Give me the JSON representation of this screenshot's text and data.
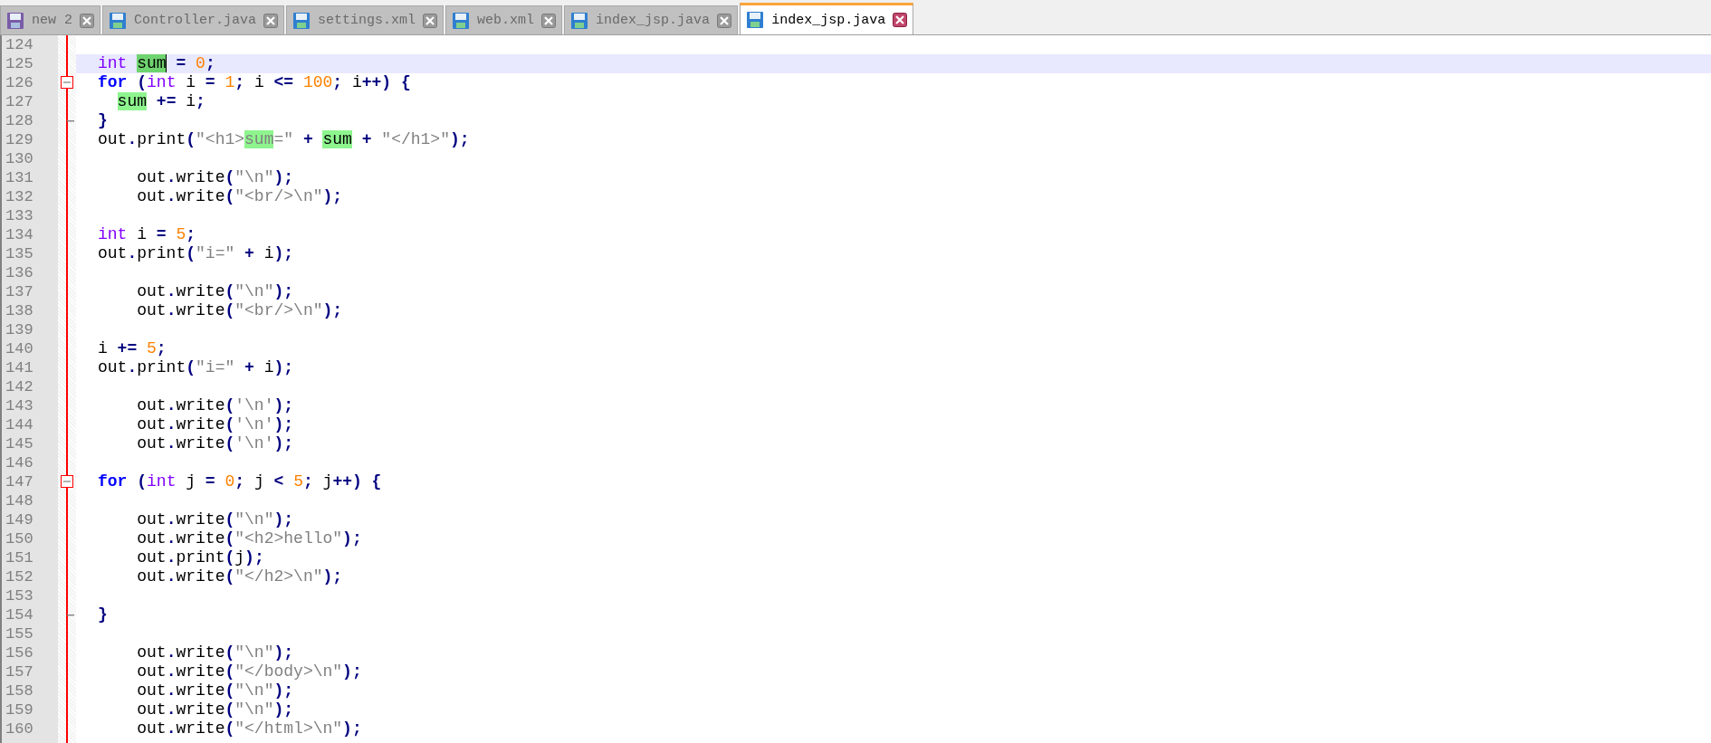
{
  "tabs": [
    {
      "label": "new 2",
      "saved": false,
      "selected": false
    },
    {
      "label": "Controller.java",
      "saved": true,
      "selected": false
    },
    {
      "label": "settings.xml",
      "saved": true,
      "selected": false
    },
    {
      "label": "web.xml",
      "saved": true,
      "selected": false
    },
    {
      "label": "index_jsp.java",
      "saved": true,
      "selected": false
    },
    {
      "label": "index_jsp.java",
      "saved": true,
      "selected": true
    }
  ],
  "editor": {
    "lines": [
      {
        "number": "124",
        "kind": "code",
        "current": false
      },
      {
        "number": "125",
        "kind": "code",
        "current": true,
        "tokens": [
          {
            "text": "int ",
            "kind": "type"
          },
          {
            "text": "sum",
            "kind": "selected"
          },
          {
            "text": " =",
            "kind": "op"
          },
          {
            "text": " 0",
            "kind": "number"
          },
          {
            "text": ";",
            "kind": "op"
          }
        ]
      },
      {
        "number": "126",
        "kind": "fold-start",
        "current": false,
        "tokens": [
          {
            "text": "for ",
            "kind": "keyword"
          },
          {
            "text": "(",
            "kind": "op"
          },
          {
            "text": "int",
            "kind": "type"
          },
          {
            "text": " i ",
            "kind": "plain"
          },
          {
            "text": "= ",
            "kind": "op"
          },
          {
            "text": "1",
            "kind": "number"
          },
          {
            "text": ";",
            "kind": "op"
          },
          {
            "text": " i ",
            "kind": "plain"
          },
          {
            "text": "<= ",
            "kind": "op"
          },
          {
            "text": "100",
            "kind": "number"
          },
          {
            "text": ";",
            "kind": "op"
          },
          {
            "text": " i",
            "kind": "plain"
          },
          {
            "text": "++) {",
            "kind": "op"
          }
        ]
      },
      {
        "number": "127",
        "kind": "code",
        "current": false,
        "tokens": [
          {
            "text": "  sum",
            "kind": "match"
          },
          {
            "text": " +=",
            "kind": "op"
          },
          {
            "text": " i",
            "kind": "plain"
          },
          {
            "text": ";",
            "kind": "op"
          }
        ]
      },
      {
        "number": "128",
        "kind": "fold-end",
        "current": false,
        "tokens": [
          {
            "text": "}",
            "kind": "op"
          }
        ]
      },
      {
        "number": "129",
        "kind": "code",
        "current": false,
        "tokens": [
          {
            "text": "out",
            "kind": "plain"
          },
          {
            "text": ".",
            "kind": "op"
          },
          {
            "text": "print",
            "kind": "plain"
          },
          {
            "text": "(",
            "kind": "op"
          },
          {
            "text": "\"<h1>",
            "kind": "string"
          },
          {
            "text": "sum",
            "kind": "string-match"
          },
          {
            "text": "=\" ",
            "kind": "string"
          },
          {
            "text": "+ ",
            "kind": "op"
          },
          {
            "text": "sum",
            "kind": "match"
          },
          {
            "text": " +",
            "kind": "op"
          },
          {
            "text": " \"</h1>\"",
            "kind": "string"
          },
          {
            "text": ");",
            "kind": "op"
          }
        ]
      },
      {
        "number": "130",
        "kind": "code",
        "current": false
      },
      {
        "number": "131",
        "kind": "code",
        "current": false,
        "tokens": [
          {
            "text": "    out",
            "kind": "plain"
          },
          {
            "text": ".",
            "kind": "op"
          },
          {
            "text": "write",
            "kind": "plain"
          },
          {
            "text": "(",
            "kind": "op"
          },
          {
            "text": "\"\\n\"",
            "kind": "string"
          },
          {
            "text": ");",
            "kind": "op"
          }
        ]
      },
      {
        "number": "132",
        "kind": "code",
        "current": false,
        "tokens": [
          {
            "text": "    out",
            "kind": "plain"
          },
          {
            "text": ".",
            "kind": "op"
          },
          {
            "text": "write",
            "kind": "plain"
          },
          {
            "text": "(",
            "kind": "op"
          },
          {
            "text": "\"<br/>\\n\"",
            "kind": "string"
          },
          {
            "text": ");",
            "kind": "op"
          }
        ]
      },
      {
        "number": "133",
        "kind": "code",
        "current": false
      },
      {
        "number": "134",
        "kind": "code",
        "current": false,
        "tokens": [
          {
            "text": "int",
            "kind": "type"
          },
          {
            "text": " i ",
            "kind": "plain"
          },
          {
            "text": "= ",
            "kind": "op"
          },
          {
            "text": "5",
            "kind": "number"
          },
          {
            "text": ";",
            "kind": "op"
          }
        ]
      },
      {
        "number": "135",
        "kind": "code",
        "current": false,
        "tokens": [
          {
            "text": "out",
            "kind": "plain"
          },
          {
            "text": ".",
            "kind": "op"
          },
          {
            "text": "print",
            "kind": "plain"
          },
          {
            "text": "(",
            "kind": "op"
          },
          {
            "text": "\"i=\" ",
            "kind": "string"
          },
          {
            "text": "+",
            "kind": "op"
          },
          {
            "text": " i",
            "kind": "plain"
          },
          {
            "text": ");",
            "kind": "op"
          }
        ]
      },
      {
        "number": "136",
        "kind": "code",
        "current": false
      },
      {
        "number": "137",
        "kind": "code",
        "current": false,
        "tokens": [
          {
            "text": "    out",
            "kind": "plain"
          },
          {
            "text": ".",
            "kind": "op"
          },
          {
            "text": "write",
            "kind": "plain"
          },
          {
            "text": "(",
            "kind": "op"
          },
          {
            "text": "\"\\n\"",
            "kind": "string"
          },
          {
            "text": ");",
            "kind": "op"
          }
        ]
      },
      {
        "number": "138",
        "kind": "code",
        "current": false,
        "tokens": [
          {
            "text": "    out",
            "kind": "plain"
          },
          {
            "text": ".",
            "kind": "op"
          },
          {
            "text": "write",
            "kind": "plain"
          },
          {
            "text": "(",
            "kind": "op"
          },
          {
            "text": "\"<br/>\\n\"",
            "kind": "string"
          },
          {
            "text": ");",
            "kind": "op"
          }
        ]
      },
      {
        "number": "139",
        "kind": "code",
        "current": false
      },
      {
        "number": "140",
        "kind": "code",
        "current": false,
        "tokens": [
          {
            "text": "i ",
            "kind": "plain"
          },
          {
            "text": "+= ",
            "kind": "op"
          },
          {
            "text": "5",
            "kind": "number"
          },
          {
            "text": ";",
            "kind": "op"
          }
        ]
      },
      {
        "number": "141",
        "kind": "code",
        "current": false,
        "tokens": [
          {
            "text": "out",
            "kind": "plain"
          },
          {
            "text": ".",
            "kind": "op"
          },
          {
            "text": "print",
            "kind": "plain"
          },
          {
            "text": "(",
            "kind": "op"
          },
          {
            "text": "\"i=\" ",
            "kind": "string"
          },
          {
            "text": "+",
            "kind": "op"
          },
          {
            "text": " i",
            "kind": "plain"
          },
          {
            "text": ");",
            "kind": "op"
          }
        ]
      },
      {
        "number": "142",
        "kind": "code",
        "current": false
      },
      {
        "number": "143",
        "kind": "code",
        "current": false,
        "tokens": [
          {
            "text": "    out",
            "kind": "plain"
          },
          {
            "text": ".",
            "kind": "op"
          },
          {
            "text": "write",
            "kind": "plain"
          },
          {
            "text": "(",
            "kind": "op"
          },
          {
            "text": "'\\n'",
            "kind": "string"
          },
          {
            "text": ");",
            "kind": "op"
          }
        ]
      },
      {
        "number": "144",
        "kind": "code",
        "current": false,
        "tokens": [
          {
            "text": "    out",
            "kind": "plain"
          },
          {
            "text": ".",
            "kind": "op"
          },
          {
            "text": "write",
            "kind": "plain"
          },
          {
            "text": "(",
            "kind": "op"
          },
          {
            "text": "'\\n'",
            "kind": "string"
          },
          {
            "text": ");",
            "kind": "op"
          }
        ]
      },
      {
        "number": "145",
        "kind": "code",
        "current": false,
        "tokens": [
          {
            "text": "    out",
            "kind": "plain"
          },
          {
            "text": ".",
            "kind": "op"
          },
          {
            "text": "write",
            "kind": "plain"
          },
          {
            "text": "(",
            "kind": "op"
          },
          {
            "text": "'\\n'",
            "kind": "string"
          },
          {
            "text": ");",
            "kind": "op"
          }
        ]
      },
      {
        "number": "146",
        "kind": "code",
        "current": false
      },
      {
        "number": "147",
        "kind": "fold-start",
        "current": false,
        "tokens": [
          {
            "text": "for ",
            "kind": "keyword"
          },
          {
            "text": "(",
            "kind": "op"
          },
          {
            "text": "int",
            "kind": "type"
          },
          {
            "text": " j ",
            "kind": "plain"
          },
          {
            "text": "= ",
            "kind": "op"
          },
          {
            "text": "0",
            "kind": "number"
          },
          {
            "text": ";",
            "kind": "op"
          },
          {
            "text": " j ",
            "kind": "plain"
          },
          {
            "text": "< ",
            "kind": "op"
          },
          {
            "text": "5",
            "kind": "number"
          },
          {
            "text": ";",
            "kind": "op"
          },
          {
            "text": " j",
            "kind": "plain"
          },
          {
            "text": "++) {",
            "kind": "op"
          }
        ]
      },
      {
        "number": "148",
        "kind": "code",
        "current": false
      },
      {
        "number": "149",
        "kind": "code",
        "current": false,
        "tokens": [
          {
            "text": "    out",
            "kind": "plain"
          },
          {
            "text": ".",
            "kind": "op"
          },
          {
            "text": "write",
            "kind": "plain"
          },
          {
            "text": "(",
            "kind": "op"
          },
          {
            "text": "\"\\n\"",
            "kind": "string"
          },
          {
            "text": ");",
            "kind": "op"
          }
        ]
      },
      {
        "number": "150",
        "kind": "code",
        "current": false,
        "tokens": [
          {
            "text": "    out",
            "kind": "plain"
          },
          {
            "text": ".",
            "kind": "op"
          },
          {
            "text": "write",
            "kind": "plain"
          },
          {
            "text": "(",
            "kind": "op"
          },
          {
            "text": "\"<h2>hello\"",
            "kind": "string"
          },
          {
            "text": ");",
            "kind": "op"
          }
        ]
      },
      {
        "number": "151",
        "kind": "code",
        "current": false,
        "tokens": [
          {
            "text": "    out",
            "kind": "plain"
          },
          {
            "text": ".",
            "kind": "op"
          },
          {
            "text": "print",
            "kind": "plain"
          },
          {
            "text": "(",
            "kind": "op"
          },
          {
            "text": "j",
            "kind": "plain"
          },
          {
            "text": ");",
            "kind": "op"
          }
        ]
      },
      {
        "number": "152",
        "kind": "code",
        "current": false,
        "tokens": [
          {
            "text": "    out",
            "kind": "plain"
          },
          {
            "text": ".",
            "kind": "op"
          },
          {
            "text": "write",
            "kind": "plain"
          },
          {
            "text": "(",
            "kind": "op"
          },
          {
            "text": "\"</h2>\\n\"",
            "kind": "string"
          },
          {
            "text": ");",
            "kind": "op"
          }
        ]
      },
      {
        "number": "153",
        "kind": "code",
        "current": false
      },
      {
        "number": "154",
        "kind": "fold-end",
        "current": false,
        "tokens": [
          {
            "text": "}",
            "kind": "op"
          }
        ]
      },
      {
        "number": "155",
        "kind": "code",
        "current": false
      },
      {
        "number": "156",
        "kind": "code",
        "current": false,
        "tokens": [
          {
            "text": "    out",
            "kind": "plain"
          },
          {
            "text": ".",
            "kind": "op"
          },
          {
            "text": "write",
            "kind": "plain"
          },
          {
            "text": "(",
            "kind": "op"
          },
          {
            "text": "\"\\n\"",
            "kind": "string"
          },
          {
            "text": ");",
            "kind": "op"
          }
        ]
      },
      {
        "number": "157",
        "kind": "code",
        "current": false,
        "tokens": [
          {
            "text": "    out",
            "kind": "plain"
          },
          {
            "text": ".",
            "kind": "op"
          },
          {
            "text": "write",
            "kind": "plain"
          },
          {
            "text": "(",
            "kind": "op"
          },
          {
            "text": "\"</body>\\n\"",
            "kind": "string"
          },
          {
            "text": ");",
            "kind": "op"
          }
        ]
      },
      {
        "number": "158",
        "kind": "code",
        "current": false,
        "tokens": [
          {
            "text": "    out",
            "kind": "plain"
          },
          {
            "text": ".",
            "kind": "op"
          },
          {
            "text": "write",
            "kind": "plain"
          },
          {
            "text": "(",
            "kind": "op"
          },
          {
            "text": "\"\\n\"",
            "kind": "string"
          },
          {
            "text": ");",
            "kind": "op"
          }
        ]
      },
      {
        "number": "159",
        "kind": "code",
        "current": false,
        "tokens": [
          {
            "text": "    out",
            "kind": "plain"
          },
          {
            "text": ".",
            "kind": "op"
          },
          {
            "text": "write",
            "kind": "plain"
          },
          {
            "text": "(",
            "kind": "op"
          },
          {
            "text": "\"\\n\"",
            "kind": "string"
          },
          {
            "text": ");",
            "kind": "op"
          }
        ]
      },
      {
        "number": "160",
        "kind": "code",
        "current": false,
        "tokens": [
          {
            "text": "    out",
            "kind": "plain"
          },
          {
            "text": ".",
            "kind": "op"
          },
          {
            "text": "write",
            "kind": "plain"
          },
          {
            "text": "(",
            "kind": "op"
          },
          {
            "text": "\"</html>\\n\"",
            "kind": "string"
          },
          {
            "text": ");",
            "kind": "op"
          }
        ]
      }
    ]
  }
}
